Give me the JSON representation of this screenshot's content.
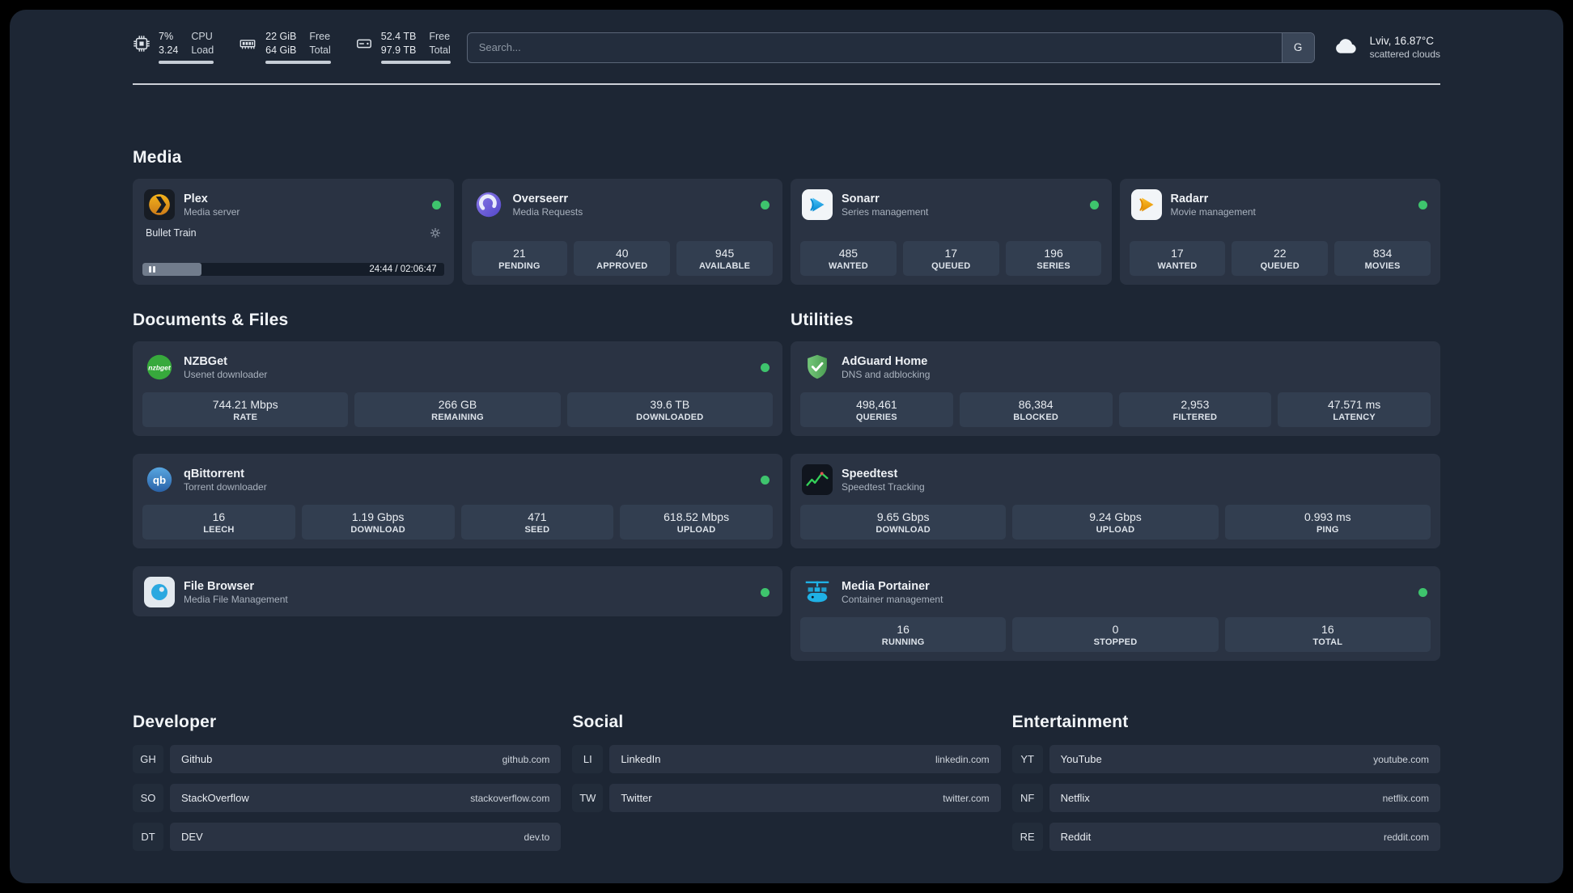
{
  "topbar": {
    "cpu": {
      "value1": "7%",
      "value2": "3.24",
      "label1": "CPU",
      "label2": "Load"
    },
    "memory": {
      "value1": "22 GiB",
      "value2": "64 GiB",
      "label1": "Free",
      "label2": "Total"
    },
    "storage": {
      "value1": "52.4 TB",
      "value2": "97.9 TB",
      "label1": "Free",
      "label2": "Total"
    },
    "search": {
      "placeholder": "Search...",
      "engine_badge": "G"
    },
    "weather": {
      "location": "Lviv, 16.87°C",
      "condition": "scattered clouds"
    }
  },
  "sections": {
    "media": "Media",
    "documents": "Documents & Files",
    "utilities": "Utilities",
    "developer": "Developer",
    "social": "Social",
    "entertainment": "Entertainment"
  },
  "apps": {
    "plex": {
      "name": "Plex",
      "subtitle": "Media server",
      "status": "online",
      "now_playing": {
        "title": "Bullet Train",
        "time": "24:44 / 02:06:47",
        "progress_percent": 19.5
      }
    },
    "overseerr": {
      "name": "Overseerr",
      "subtitle": "Media Requests",
      "status": "online",
      "stats": [
        {
          "value": "21",
          "label": "PENDING"
        },
        {
          "value": "40",
          "label": "APPROVED"
        },
        {
          "value": "945",
          "label": "AVAILABLE"
        }
      ]
    },
    "sonarr": {
      "name": "Sonarr",
      "subtitle": "Series management",
      "status": "online",
      "stats": [
        {
          "value": "485",
          "label": "WANTED"
        },
        {
          "value": "17",
          "label": "QUEUED"
        },
        {
          "value": "196",
          "label": "SERIES"
        }
      ]
    },
    "radarr": {
      "name": "Radarr",
      "subtitle": "Movie management",
      "status": "online",
      "stats": [
        {
          "value": "17",
          "label": "WANTED"
        },
        {
          "value": "22",
          "label": "QUEUED"
        },
        {
          "value": "834",
          "label": "MOVIES"
        }
      ]
    },
    "nzbget": {
      "name": "NZBGet",
      "subtitle": "Usenet downloader",
      "status": "online",
      "stats": [
        {
          "value": "744.21 Mbps",
          "label": "RATE"
        },
        {
          "value": "266 GB",
          "label": "REMAINING"
        },
        {
          "value": "39.6 TB",
          "label": "DOWNLOADED"
        }
      ]
    },
    "qbittorrent": {
      "name": "qBittorrent",
      "subtitle": "Torrent downloader",
      "status": "online",
      "stats": [
        {
          "value": "16",
          "label": "LEECH"
        },
        {
          "value": "1.19 Gbps",
          "label": "DOWNLOAD"
        },
        {
          "value": "471",
          "label": "SEED"
        },
        {
          "value": "618.52 Mbps",
          "label": "UPLOAD"
        }
      ]
    },
    "filebrowser": {
      "name": "File Browser",
      "subtitle": "Media File Management",
      "status": "online"
    },
    "adguard": {
      "name": "AdGuard Home",
      "subtitle": "DNS and adblocking",
      "stats": [
        {
          "value": "498,461",
          "label": "QUERIES"
        },
        {
          "value": "86,384",
          "label": "BLOCKED"
        },
        {
          "value": "2,953",
          "label": "FILTERED"
        },
        {
          "value": "47.571 ms",
          "label": "LATENCY"
        }
      ]
    },
    "speedtest": {
      "name": "Speedtest",
      "subtitle": "Speedtest Tracking",
      "stats": [
        {
          "value": "9.65 Gbps",
          "label": "DOWNLOAD"
        },
        {
          "value": "9.24 Gbps",
          "label": "UPLOAD"
        },
        {
          "value": "0.993 ms",
          "label": "PING"
        }
      ]
    },
    "portainer": {
      "name": "Media Portainer",
      "subtitle": "Container management",
      "status": "online",
      "stats": [
        {
          "value": "16",
          "label": "RUNNING"
        },
        {
          "value": "0",
          "label": "STOPPED"
        },
        {
          "value": "16",
          "label": "TOTAL"
        }
      ]
    }
  },
  "bookmarks": {
    "developer": [
      {
        "abbr": "GH",
        "name": "Github",
        "url": "github.com"
      },
      {
        "abbr": "SO",
        "name": "StackOverflow",
        "url": "stackoverflow.com"
      },
      {
        "abbr": "DT",
        "name": "DEV",
        "url": "dev.to"
      }
    ],
    "social": [
      {
        "abbr": "LI",
        "name": "LinkedIn",
        "url": "linkedin.com"
      },
      {
        "abbr": "TW",
        "name": "Twitter",
        "url": "twitter.com"
      }
    ],
    "entertainment": [
      {
        "abbr": "YT",
        "name": "YouTube",
        "url": "youtube.com"
      },
      {
        "abbr": "NF",
        "name": "Netflix",
        "url": "netflix.com"
      },
      {
        "abbr": "RE",
        "name": "Reddit",
        "url": "reddit.com"
      }
    ]
  },
  "colors": {
    "bg": "#1d2634",
    "card": "#2a3343",
    "tile": "#323e50",
    "green": "#3ec46d",
    "text": "#e9edf2",
    "muted": "#a7b0bc",
    "plex": "#e5a00d",
    "overseerr": "#6c5ce7",
    "sonarr": "#2bb3e4",
    "radarr": "#f5a623",
    "nzbget": "#39a83e",
    "qbittorrent": "#2f7bc4",
    "filebrowser": "#2baee0",
    "adguard": "#5cb85c",
    "speedtest": "#34d058",
    "portainer": "#1fb1e6"
  }
}
